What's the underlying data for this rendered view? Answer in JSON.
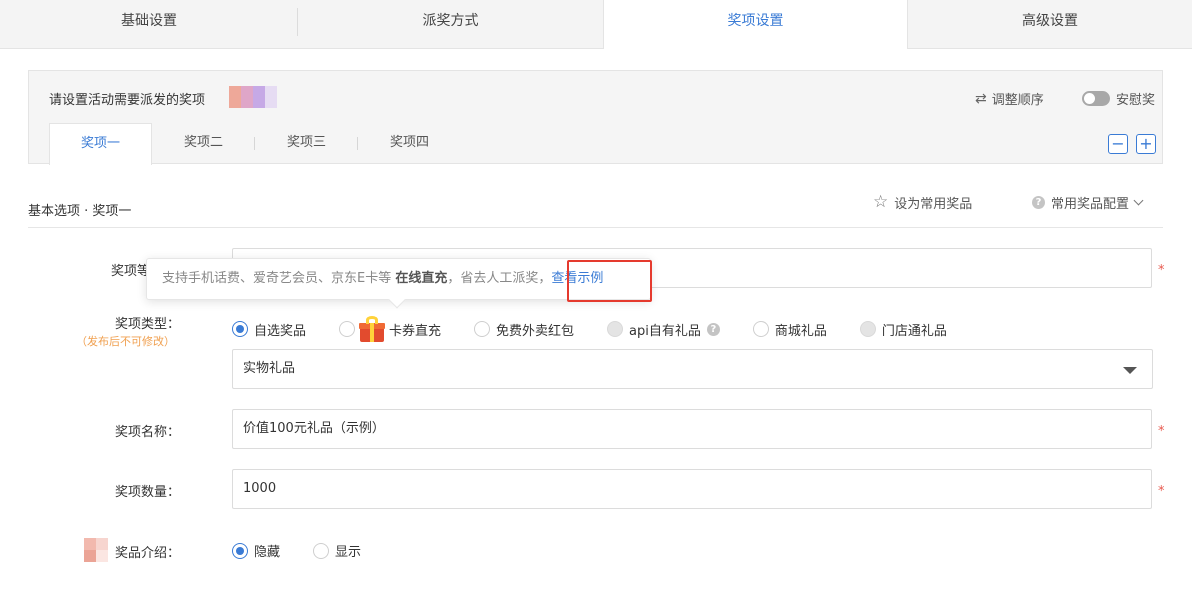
{
  "top_tabs": [
    {
      "label": "基础设置"
    },
    {
      "label": "派奖方式"
    },
    {
      "label": "奖项设置",
      "active": true
    },
    {
      "label": "高级设置"
    }
  ],
  "prize_panel": {
    "title": "请设置活动需要派发的奖项",
    "reorder_label": "调整顺序",
    "consolation_label": "安慰奖",
    "sub_tabs": [
      {
        "label": "奖项一",
        "active": true
      },
      {
        "label": "奖项二"
      },
      {
        "label": "奖项三"
      },
      {
        "label": "奖项四"
      }
    ],
    "minus_label": "−",
    "plus_label": "+"
  },
  "section": {
    "title": "基本选项 · 奖项一",
    "favorite_label": "设为常用奖品",
    "favorite_config_label": "常用奖品配置"
  },
  "tooltip": {
    "text_before": "支持手机话费、爱奇艺会员、京东E卡等",
    "bold_text": "在线直充",
    "text_after": "，省去人工派奖，",
    "link_text": "查看示例"
  },
  "form": {
    "prize_label_partial": "奖项等",
    "prize_type_label": "奖项类型：",
    "prize_type_hint": "（发布后不可修改）",
    "prize_type_options": [
      {
        "label": "自选奖品",
        "state": "selected"
      },
      {
        "label": "卡券直充",
        "state": "unselected"
      },
      {
        "label": "免费外卖红包",
        "state": "unselected"
      },
      {
        "label": "api自有礼品",
        "state": "disabled"
      },
      {
        "label": "商城礼品",
        "state": "unselected"
      },
      {
        "label": "门店通礼品",
        "state": "disabled"
      }
    ],
    "prize_category_value": "实物礼品",
    "prize_name_label": "奖项名称：",
    "prize_name_value": "价值100元礼品（示例）",
    "prize_count_label": "奖项数量：",
    "prize_count_value": "1000",
    "prize_intro_label": "奖品介绍：",
    "prize_intro_options": [
      {
        "label": "隐藏",
        "state": "selected"
      },
      {
        "label": "显示",
        "state": "unselected"
      }
    ],
    "required_mark": "*"
  },
  "colors": {
    "accent": "#3a7bd5",
    "required": "#e85a4f",
    "hint": "#f0a050",
    "highlight_box": "#e53a2e"
  },
  "icons": {
    "reorder": "swap-arrows-icon",
    "favorite": "star-outline-icon",
    "help": "question-circle-icon",
    "gift": "gift-box-icon"
  }
}
